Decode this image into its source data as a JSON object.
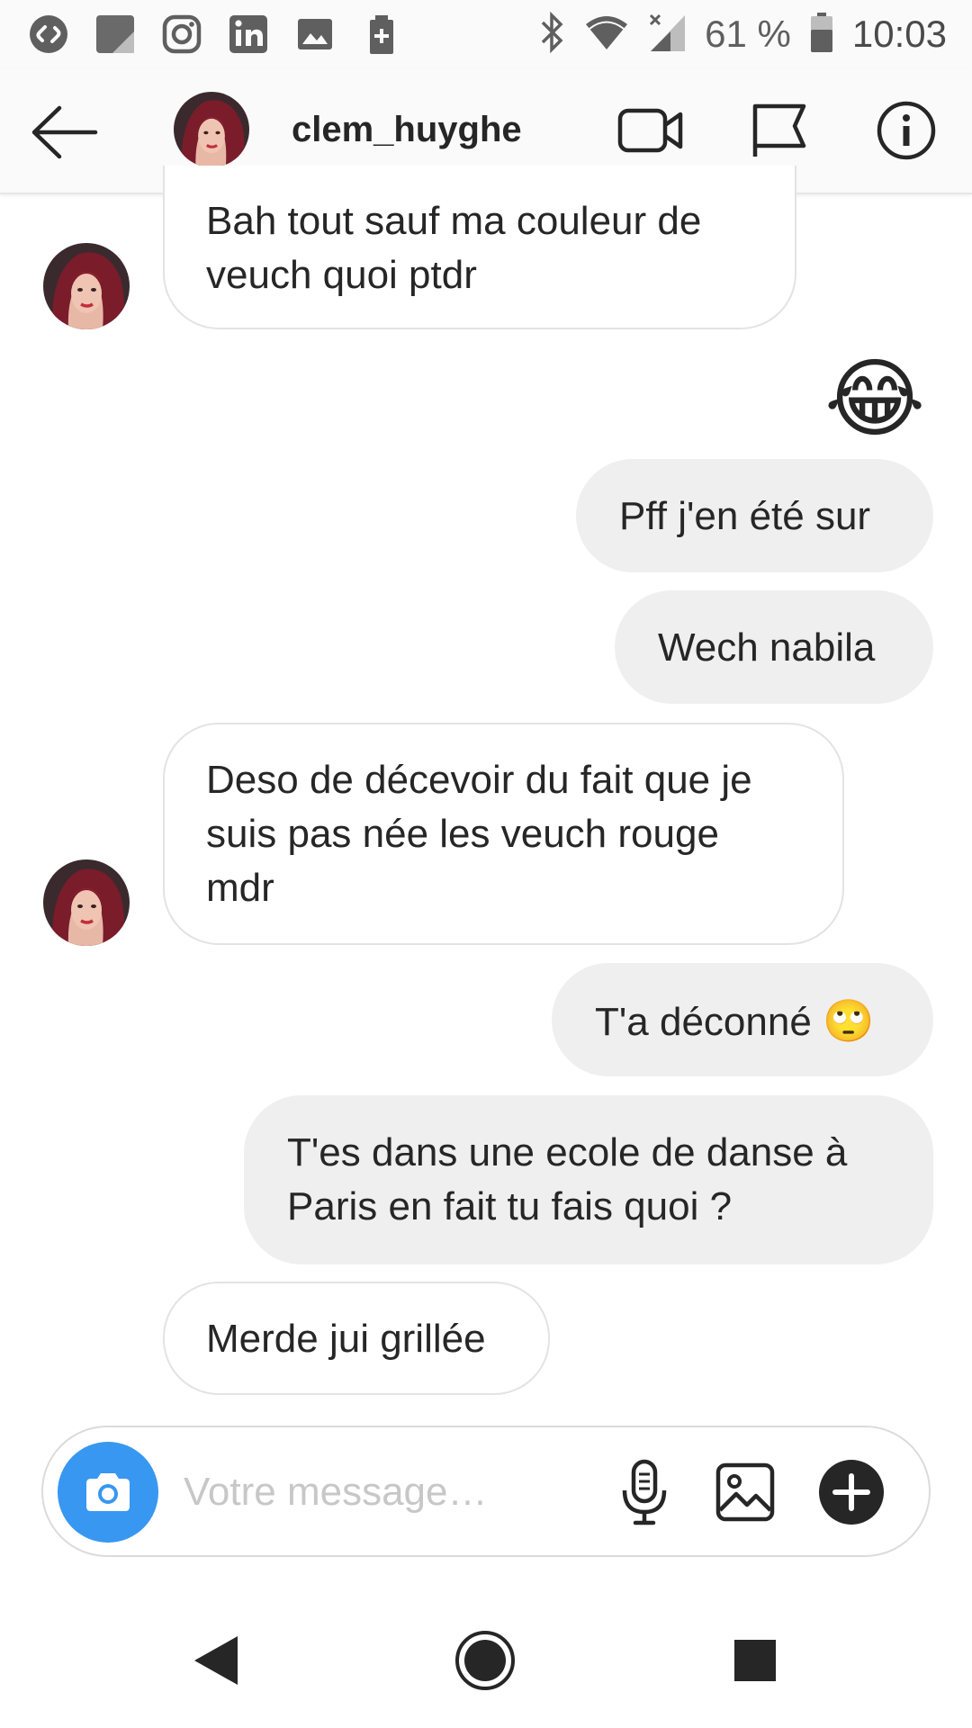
{
  "status_bar": {
    "battery": "61 %",
    "time": "10:03",
    "left_icons": [
      "shazam-icon",
      "notes-icon",
      "instagram-icon",
      "linkedin-icon",
      "gallery-icon",
      "battery-saver-icon"
    ],
    "right_icons": [
      "bluetooth-icon",
      "wifi-icon",
      "signal-icon",
      "battery-icon"
    ]
  },
  "header": {
    "username": "clem_huyghe",
    "icons": [
      "back-arrow-icon",
      "video-call-icon",
      "flag-icon",
      "info-icon"
    ]
  },
  "messages": [
    {
      "from": "them",
      "text_lines": [
        "Bah tout sauf ma couleur de",
        "veuch quoi ptdr"
      ]
    },
    {
      "from": "me",
      "emoji": "😂"
    },
    {
      "from": "me",
      "text": "Pff j'en été sur"
    },
    {
      "from": "me",
      "text": "Wech nabila"
    },
    {
      "from": "them",
      "text_lines": [
        "Deso de décevoir du fait que je",
        "suis pas née les veuch rouge",
        "mdr"
      ]
    },
    {
      "from": "me",
      "text": "T'a déconné",
      "emoji": "🙄"
    },
    {
      "from": "me",
      "text_lines": [
        "T'es dans une ecole de danse à",
        "Paris en fait tu fais quoi ?"
      ]
    },
    {
      "from": "them",
      "text": "Merde jui grillée"
    }
  ],
  "composer": {
    "placeholder": "Votre message…",
    "icons": [
      "camera-icon",
      "microphone-icon",
      "gallery-icon",
      "plus-icon"
    ]
  },
  "colors": {
    "camera_button": "#3897f0",
    "outgoing_bubble": "#efefef",
    "incoming_border": "#e3e3e3",
    "text": "#262626"
  }
}
